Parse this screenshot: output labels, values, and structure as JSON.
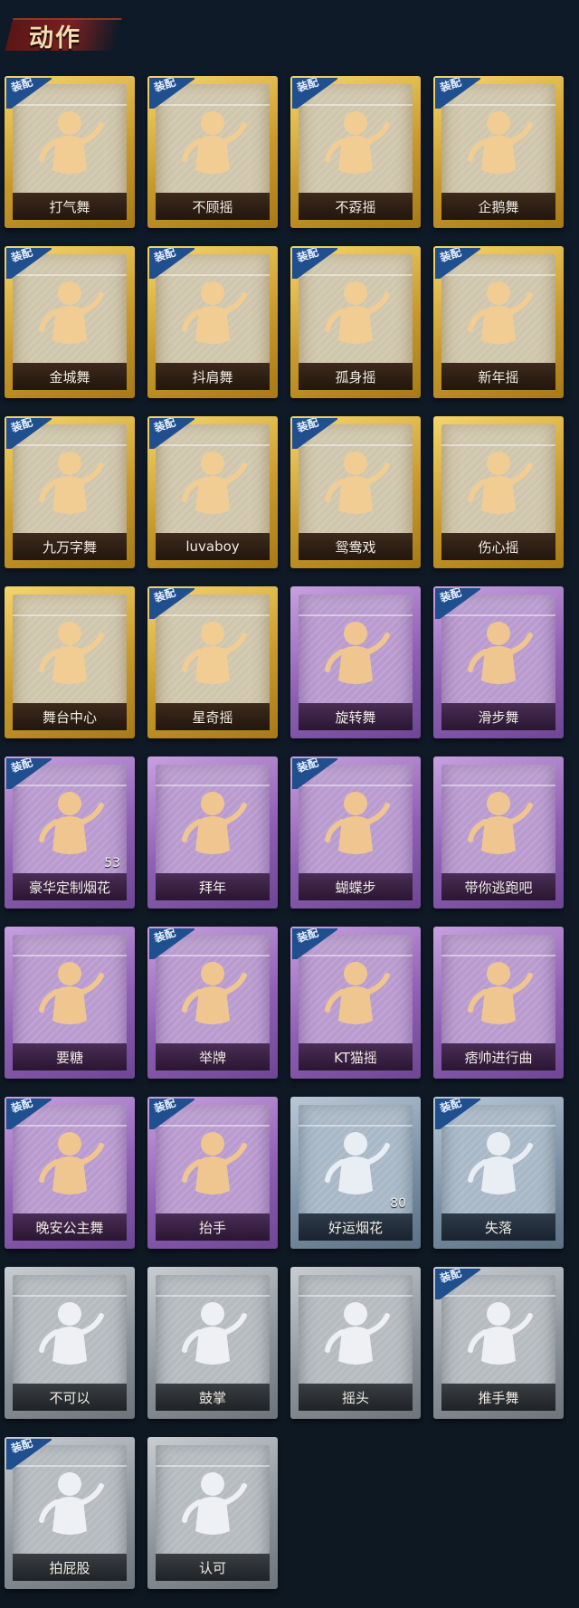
{
  "header": {
    "title": "动作"
  },
  "badge_label": "装配",
  "colors": {
    "gold": "#c99a2a",
    "purple": "#8f60b4",
    "blue": "#7d92a6",
    "grey": "#8e959c",
    "badge": "#1f4f8f"
  },
  "cards": [
    {
      "label": "打气舞",
      "rarity": "gold",
      "equipped": true,
      "icon": "cheer-dance-icon"
    },
    {
      "label": "不顾摇",
      "rarity": "gold",
      "equipped": true,
      "icon": "carefree-shake-icon"
    },
    {
      "label": "不孬摇",
      "rarity": "gold",
      "equipped": true,
      "icon": "brave-shake-icon"
    },
    {
      "label": "企鹅舞",
      "rarity": "gold",
      "equipped": true,
      "icon": "penguin-dance-icon"
    },
    {
      "label": "金城舞",
      "rarity": "gold",
      "equipped": true,
      "icon": "golden-city-dance-icon"
    },
    {
      "label": "抖肩舞",
      "rarity": "gold",
      "equipped": true,
      "icon": "shoulder-shake-icon"
    },
    {
      "label": "孤身摇",
      "rarity": "gold",
      "equipped": true,
      "icon": "lonely-shake-icon"
    },
    {
      "label": "新年摇",
      "rarity": "gold",
      "equipped": true,
      "icon": "new-year-shake-icon"
    },
    {
      "label": "九万字舞",
      "rarity": "gold",
      "equipped": true,
      "icon": "ninety-thousand-dance-icon"
    },
    {
      "label": "luvaboy",
      "rarity": "gold",
      "equipped": true,
      "icon": "luvaboy-icon"
    },
    {
      "label": "鸳鸯戏",
      "rarity": "gold",
      "equipped": true,
      "icon": "mandarin-duck-icon"
    },
    {
      "label": "伤心摇",
      "rarity": "gold",
      "equipped": false,
      "icon": "heartbreak-shake-icon"
    },
    {
      "label": "舞台中心",
      "rarity": "gold",
      "equipped": false,
      "icon": "center-stage-icon"
    },
    {
      "label": "星奇摇",
      "rarity": "gold",
      "equipped": true,
      "icon": "star-shake-icon"
    },
    {
      "label": "旋转舞",
      "rarity": "purple",
      "equipped": false,
      "icon": "spin-dance-icon"
    },
    {
      "label": "滑步舞",
      "rarity": "purple",
      "equipped": true,
      "icon": "slide-step-icon"
    },
    {
      "label": "豪华定制烟花",
      "rarity": "purple",
      "equipped": true,
      "icon": "deluxe-fireworks-icon",
      "count": "53"
    },
    {
      "label": "拜年",
      "rarity": "purple",
      "equipped": false,
      "icon": "new-year-greeting-icon"
    },
    {
      "label": "蝴蝶步",
      "rarity": "purple",
      "equipped": true,
      "icon": "butterfly-step-icon"
    },
    {
      "label": "带你逃跑吧",
      "rarity": "purple",
      "equipped": false,
      "icon": "run-away-icon"
    },
    {
      "label": "要糖",
      "rarity": "purple",
      "equipped": false,
      "icon": "ask-candy-icon"
    },
    {
      "label": "举牌",
      "rarity": "purple",
      "equipped": true,
      "icon": "hold-sign-icon"
    },
    {
      "label": "KT猫摇",
      "rarity": "purple",
      "equipped": true,
      "icon": "kt-cat-shake-icon"
    },
    {
      "label": "痞帅进行曲",
      "rarity": "purple",
      "equipped": false,
      "icon": "cool-march-icon"
    },
    {
      "label": "晚安公主舞",
      "rarity": "purple",
      "equipped": true,
      "icon": "goodnight-princess-icon"
    },
    {
      "label": "抬手",
      "rarity": "purple",
      "equipped": true,
      "icon": "raise-hand-icon"
    },
    {
      "label": "好运烟花",
      "rarity": "blue",
      "equipped": false,
      "icon": "lucky-fireworks-icon",
      "count": "80"
    },
    {
      "label": "失落",
      "rarity": "blue",
      "equipped": true,
      "icon": "dejected-icon"
    },
    {
      "label": "不可以",
      "rarity": "grey",
      "equipped": false,
      "icon": "no-finger-icon"
    },
    {
      "label": "鼓掌",
      "rarity": "grey",
      "equipped": false,
      "icon": "clap-icon"
    },
    {
      "label": "摇头",
      "rarity": "grey",
      "equipped": false,
      "icon": "shake-head-icon"
    },
    {
      "label": "推手舞",
      "rarity": "grey",
      "equipped": true,
      "icon": "push-hands-icon"
    },
    {
      "label": "拍屁股",
      "rarity": "grey",
      "equipped": true,
      "icon": "pat-butt-icon"
    },
    {
      "label": "认可",
      "rarity": "grey",
      "equipped": false,
      "icon": "thumbs-up-icon"
    }
  ]
}
